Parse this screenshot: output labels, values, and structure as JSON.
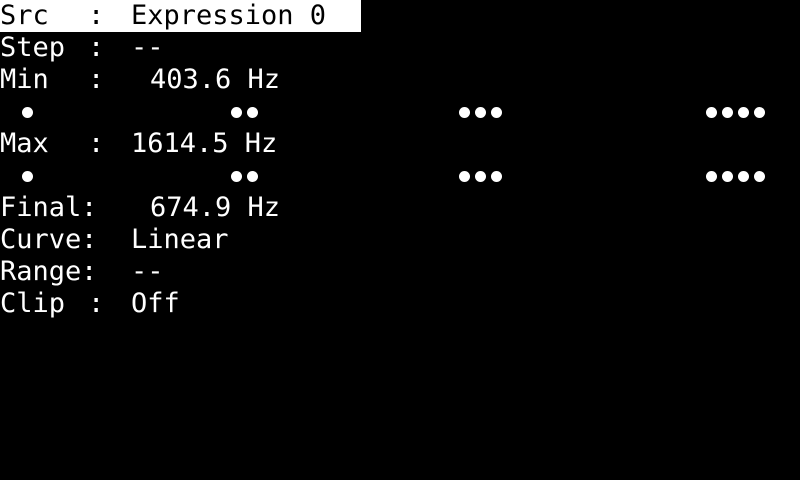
{
  "menu": {
    "rows": [
      {
        "label": "Src",
        "sep": ":",
        "value": "Expression 0",
        "selected": true
      },
      {
        "label": "Step",
        "sep": ":",
        "value": "--"
      },
      {
        "label": "Min",
        "sep": ":",
        "value": "403.6 Hz"
      },
      {
        "label": "Max",
        "sep": ":",
        "value": "1614.5 Hz"
      },
      {
        "label": "Final",
        "sep": ":",
        "value": "674.9 Hz"
      },
      {
        "label": "Curve",
        "sep": ":",
        "value": "Linear"
      },
      {
        "label": "Range",
        "sep": ":",
        "value": "--"
      },
      {
        "label": "Clip",
        "sep": ":",
        "value": "Off"
      }
    ]
  },
  "colors": {
    "background": "#000000",
    "text": "#ffffff",
    "highlight_bg": "#ffffff",
    "highlight_text": "#000000"
  }
}
